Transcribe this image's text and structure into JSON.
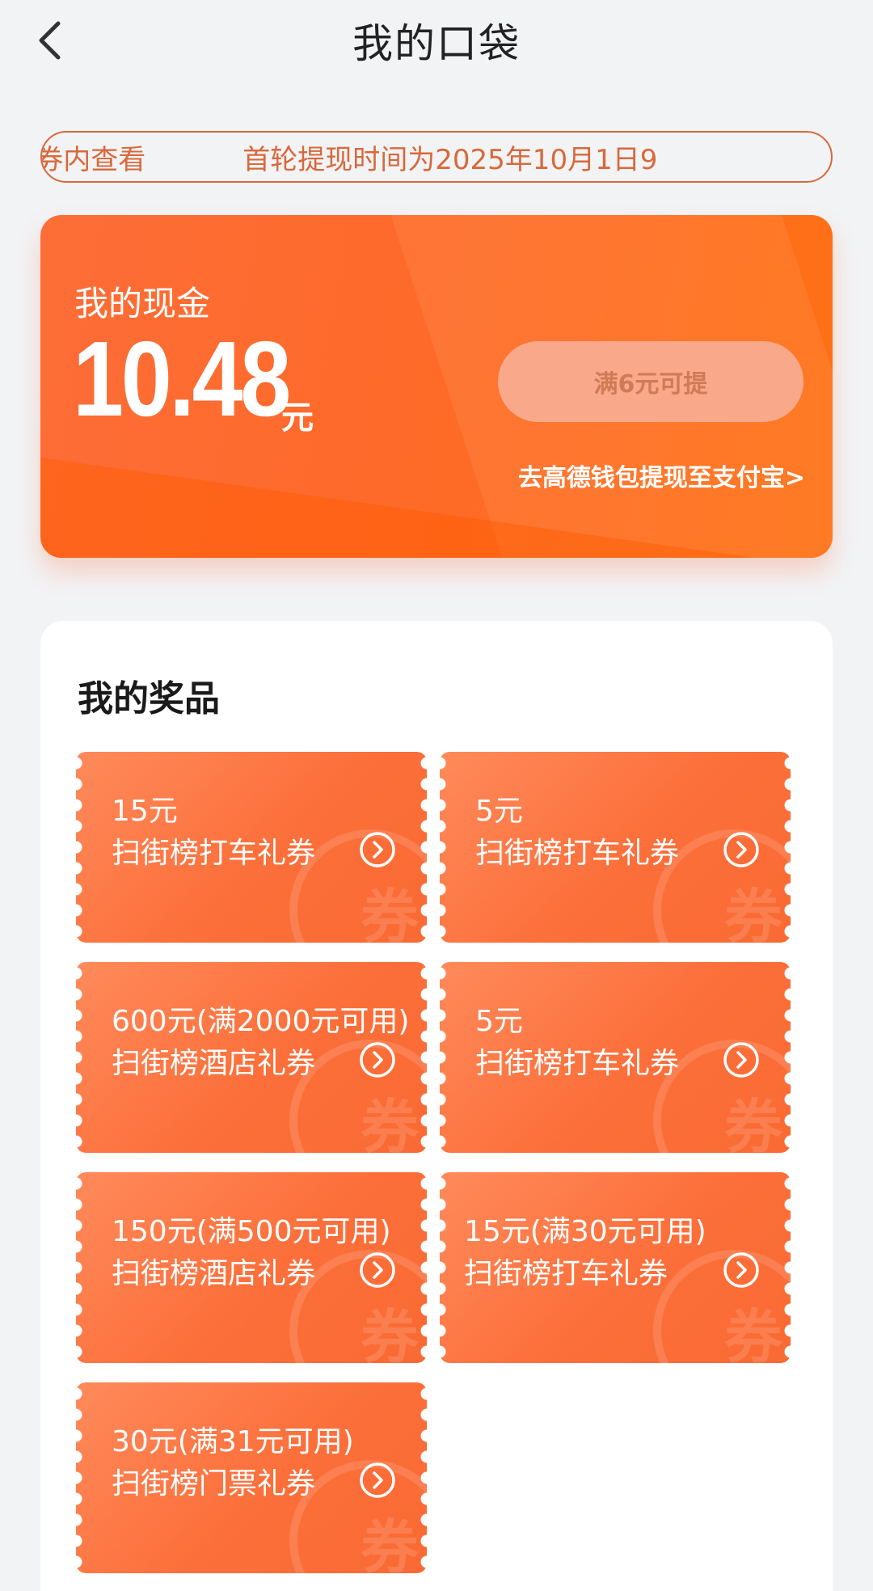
{
  "header": {
    "title": "我的口袋",
    "back_icon": "chevron-left-icon"
  },
  "notice": {
    "segments": [
      "我的-钱包卡券内查看",
      "首轮提现时间为2025年10月1日9"
    ]
  },
  "cash": {
    "label": "我的现金",
    "amount": "10.48",
    "unit": "元",
    "withdraw_button": "满6元可提",
    "wallet_link": "去高德钱包提现至支付宝>"
  },
  "prizes": {
    "title": "我的奖品",
    "watermark": "券",
    "coupons": [
      {
        "amount": "15元",
        "name": "扫街榜打车礼券"
      },
      {
        "amount": "5元",
        "name": "扫街榜打车礼券"
      },
      {
        "amount": "600元(满2000元可用)",
        "name": "扫街榜酒店礼券"
      },
      {
        "amount": "5元",
        "name": "扫街榜打车礼券"
      },
      {
        "amount": "150元(满500元可用)",
        "name": "扫街榜酒店礼券"
      },
      {
        "amount": "15元(满30元可用)",
        "name": "扫街榜打车礼券"
      },
      {
        "amount": "30元(满31元可用)",
        "name": "扫街榜门票礼券"
      }
    ]
  },
  "colors": {
    "accent": "#fd6d37",
    "notice_border": "#d9683a",
    "background": "#f2f3f5"
  }
}
